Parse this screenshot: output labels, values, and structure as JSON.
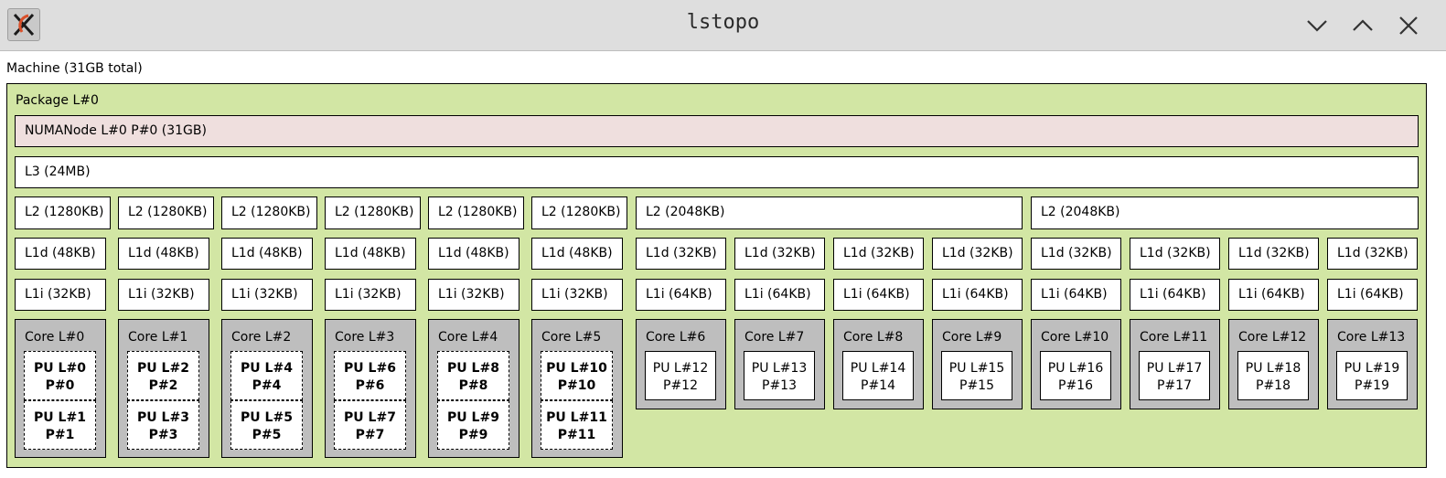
{
  "window": {
    "title": "lstopo",
    "app_icon": "x11-logo-icon",
    "buttons": [
      "minimize-icon",
      "maximize-icon",
      "close-icon"
    ]
  },
  "machine": {
    "label": "Machine (31GB total)"
  },
  "package": {
    "label": "Package L#0"
  },
  "numa": {
    "label": "NUMANode L#0 P#0 (31GB)"
  },
  "l3": {
    "label": "L3 (24MB)"
  },
  "l2": [
    "L2 (1280KB)",
    "L2 (1280KB)",
    "L2 (1280KB)",
    "L2 (1280KB)",
    "L2 (1280KB)",
    "L2 (1280KB)",
    "L2 (2048KB)",
    "L2 (2048KB)"
  ],
  "l1d": [
    "L1d (48KB)",
    "L1d (48KB)",
    "L1d (48KB)",
    "L1d (48KB)",
    "L1d (48KB)",
    "L1d (48KB)",
    "L1d (32KB)",
    "L1d (32KB)",
    "L1d (32KB)",
    "L1d (32KB)",
    "L1d (32KB)",
    "L1d (32KB)",
    "L1d (32KB)",
    "L1d (32KB)"
  ],
  "l1i": [
    "L1i (32KB)",
    "L1i (32KB)",
    "L1i (32KB)",
    "L1i (32KB)",
    "L1i (32KB)",
    "L1i (32KB)",
    "L1i (64KB)",
    "L1i (64KB)",
    "L1i (64KB)",
    "L1i (64KB)",
    "L1i (64KB)",
    "L1i (64KB)",
    "L1i (64KB)",
    "L1i (64KB)"
  ],
  "cores": [
    {
      "label": "Core L#0",
      "pus": [
        [
          "PU L#0",
          "P#0"
        ],
        [
          "PU L#1",
          "P#1"
        ]
      ]
    },
    {
      "label": "Core L#1",
      "pus": [
        [
          "PU L#2",
          "P#2"
        ],
        [
          "PU L#3",
          "P#3"
        ]
      ]
    },
    {
      "label": "Core L#2",
      "pus": [
        [
          "PU L#4",
          "P#4"
        ],
        [
          "PU L#5",
          "P#5"
        ]
      ]
    },
    {
      "label": "Core L#3",
      "pus": [
        [
          "PU L#6",
          "P#6"
        ],
        [
          "PU L#7",
          "P#7"
        ]
      ]
    },
    {
      "label": "Core L#4",
      "pus": [
        [
          "PU L#8",
          "P#8"
        ],
        [
          "PU L#9",
          "P#9"
        ]
      ]
    },
    {
      "label": "Core L#5",
      "pus": [
        [
          "PU L#10",
          "P#10"
        ],
        [
          "PU L#11",
          "P#11"
        ]
      ]
    },
    {
      "label": "Core L#6",
      "pus": [
        [
          "PU L#12",
          "P#12"
        ]
      ]
    },
    {
      "label": "Core L#7",
      "pus": [
        [
          "PU L#13",
          "P#13"
        ]
      ]
    },
    {
      "label": "Core L#8",
      "pus": [
        [
          "PU L#14",
          "P#14"
        ]
      ]
    },
    {
      "label": "Core L#9",
      "pus": [
        [
          "PU L#15",
          "P#15"
        ]
      ]
    },
    {
      "label": "Core L#10",
      "pus": [
        [
          "PU L#16",
          "P#16"
        ]
      ]
    },
    {
      "label": "Core L#11",
      "pus": [
        [
          "PU L#17",
          "P#17"
        ]
      ]
    },
    {
      "label": "Core L#12",
      "pus": [
        [
          "PU L#18",
          "P#18"
        ]
      ]
    },
    {
      "label": "Core L#13",
      "pus": [
        [
          "PU L#19",
          "P#19"
        ]
      ]
    }
  ]
}
